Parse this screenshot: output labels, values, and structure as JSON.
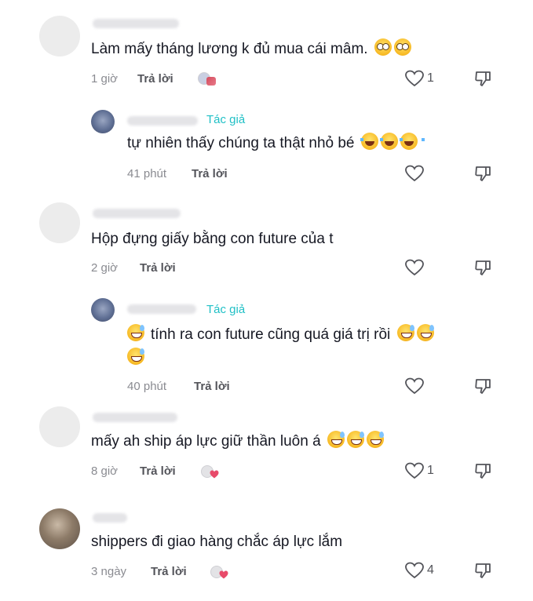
{
  "comments": [
    {
      "time": "1 giờ",
      "reply": "Trả lời",
      "likes": "1",
      "text": "Làm mấy tháng lương k đủ mua cái mâm.",
      "emoji": "flushed-face-emoji"
    },
    {
      "author_tag": "Tác giả",
      "time": "41 phút",
      "reply": "Trả lời",
      "likes": "",
      "text": "tự nhiên thấy chúng ta thật nhỏ bé",
      "emoji": "tears-of-joy-emoji"
    },
    {
      "time": "2 giờ",
      "reply": "Trả lời",
      "likes": "",
      "text": "Hộp đựng giấy bằng con future của t"
    },
    {
      "author_tag": "Tác giả",
      "time": "40 phút",
      "reply": "Trả lời",
      "likes": "",
      "text": "tính ra con future cũng quá giá trị rồi",
      "emoji": "grinning-sweat-emoji"
    },
    {
      "time": "8 giờ",
      "reply": "Trả lời",
      "likes": "1",
      "text": "mấy ah ship áp lực giữ thần luôn á",
      "emoji": "grinning-sweat-emoji"
    },
    {
      "time": "3 ngày",
      "reply": "Trả lời",
      "likes": "4",
      "text": "shippers đi giao hàng chắc áp lực lắm"
    }
  ],
  "icons": {
    "like": "heart-outline-icon",
    "dislike": "thumbs-down-icon"
  }
}
